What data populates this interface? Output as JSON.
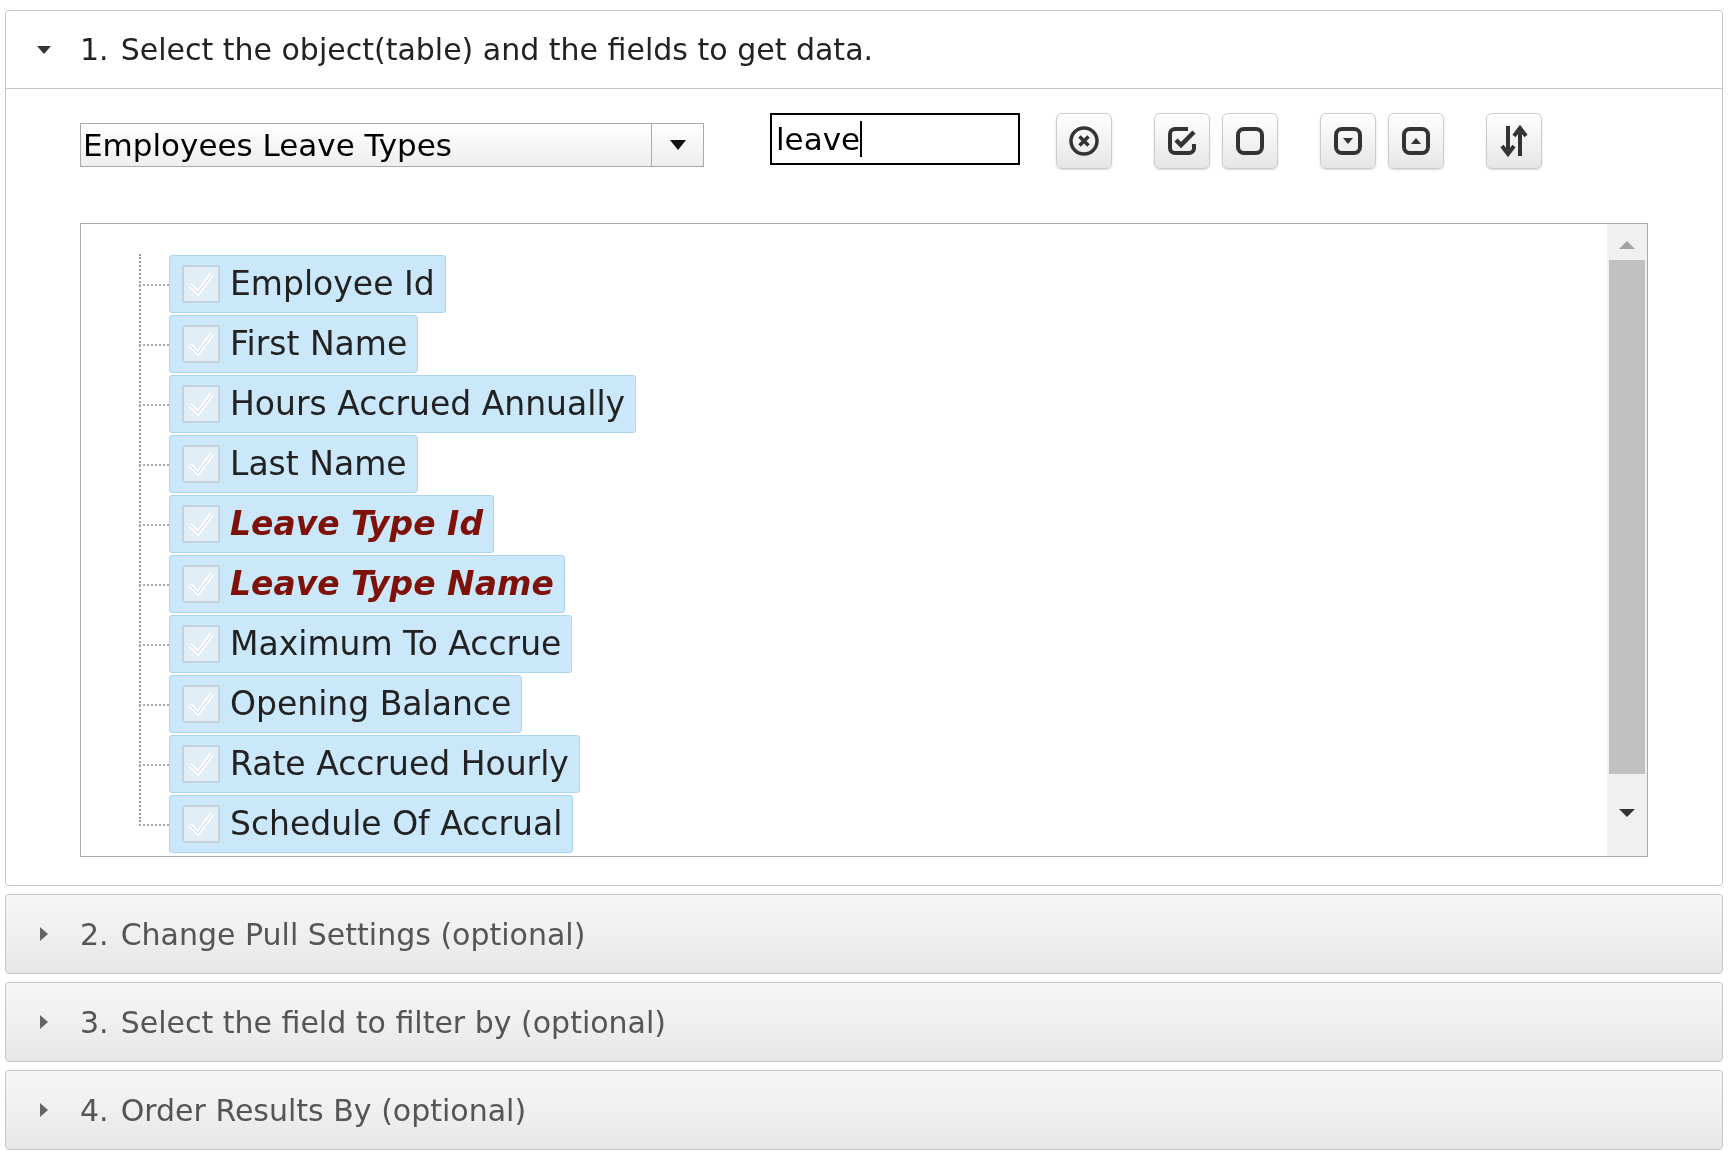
{
  "sections": [
    {
      "number": "1.",
      "title": "Select the object(table) and the fields to get data.",
      "expanded": true
    },
    {
      "number": "2.",
      "title": "Change Pull Settings (optional)",
      "expanded": false
    },
    {
      "number": "3.",
      "title": "Select the field to filter by (optional)",
      "expanded": false
    },
    {
      "number": "4.",
      "title": "Order Results By (optional)",
      "expanded": false
    }
  ],
  "object_select": {
    "value": "Employees Leave Types"
  },
  "search": {
    "value": "leave"
  },
  "toolbar": [
    {
      "kind": "clear"
    },
    {
      "kind": "check-all"
    },
    {
      "kind": "uncheck-all"
    },
    {
      "kind": "expand"
    },
    {
      "kind": "collapse"
    },
    {
      "kind": "sort"
    }
  ],
  "fields": [
    {
      "label": "Employee Id",
      "checked": true,
      "match": false
    },
    {
      "label": "First Name",
      "checked": true,
      "match": false
    },
    {
      "label": "Hours Accrued Annually",
      "checked": true,
      "match": false
    },
    {
      "label": "Last Name",
      "checked": true,
      "match": false
    },
    {
      "label": "Leave Type Id",
      "checked": true,
      "match": true
    },
    {
      "label": "Leave Type Name",
      "checked": true,
      "match": true
    },
    {
      "label": "Maximum To Accrue",
      "checked": true,
      "match": false
    },
    {
      "label": "Opening Balance",
      "checked": true,
      "match": false
    },
    {
      "label": "Rate Accrued Hourly",
      "checked": true,
      "match": false
    },
    {
      "label": "Schedule Of Accrual",
      "checked": true,
      "match": false
    }
  ]
}
